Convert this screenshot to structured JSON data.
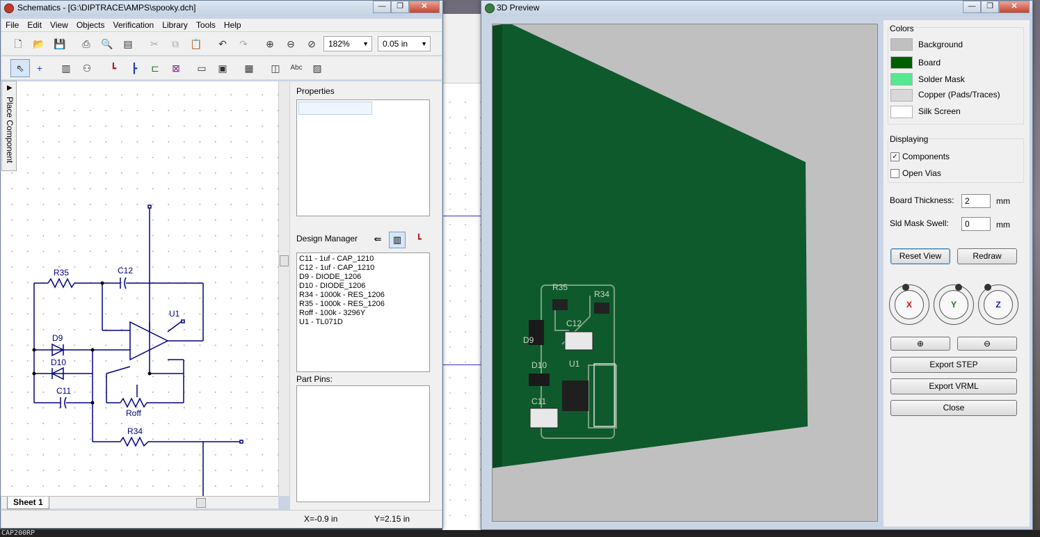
{
  "schematic_window": {
    "title": "Schematics - [G:\\DIPTRACE\\AMPS\\spooky.dch]",
    "menu": [
      "File",
      "Edit",
      "View",
      "Objects",
      "Verification",
      "Library",
      "Tools",
      "Help"
    ],
    "zoom": "182%",
    "grid": "0.05 in",
    "side_tab": "Place Component",
    "sheet_tab": "Sheet 1",
    "properties_label": "Properties",
    "design_manager_label": "Design Manager",
    "design_manager_items": [
      "C11 - 1uf - CAP_1210",
      "C12 - 1uf - CAP_1210",
      "D9 - DIODE_1206",
      "D10 - DIODE_1206",
      "R34 - 1000k - RES_1206",
      "R35 - 1000k - RES_1206",
      "Roff - 100k - 3296Y",
      "U1 - TL071D"
    ],
    "part_pins_label": "Part Pins:",
    "status_x": "X=-0.9 in",
    "status_y": "Y=2.15 in",
    "schematic_labels": {
      "r35": "R35",
      "c12": "C12",
      "u1": "U1",
      "d9": "D9",
      "d10": "D10",
      "c11": "C11",
      "roff": "Roff",
      "r34": "R34"
    }
  },
  "preview_window": {
    "title": "3D Preview",
    "colors_label": "Colors",
    "colors": [
      {
        "label": "Background",
        "hex": "#c0c0c0"
      },
      {
        "label": "Board",
        "hex": "#006000"
      },
      {
        "label": "Solder Mask",
        "hex": "#55e890"
      },
      {
        "label": "Copper (Pads/Traces)",
        "hex": "#d8d8d8"
      },
      {
        "label": "Silk Screen",
        "hex": "#ffffff"
      }
    ],
    "displaying_label": "Displaying",
    "components_label": "Components",
    "components_checked": true,
    "open_vias_label": "Open Vias",
    "open_vias_checked": false,
    "board_thickness_label": "Board Thickness:",
    "board_thickness_value": "2",
    "board_thickness_unit": "mm",
    "mask_swell_label": "Sld Mask Swell:",
    "mask_swell_value": "0",
    "mask_swell_unit": "mm",
    "reset_view": "Reset View",
    "redraw": "Redraw",
    "axes": [
      "X",
      "Y",
      "Z"
    ],
    "export_step": "Export STEP",
    "export_vrml": "Export VRML",
    "close": "Close",
    "board_labels": [
      "R35",
      "R34",
      "D9",
      "C12",
      "D10",
      "U1",
      "C11"
    ]
  },
  "taskbar_fragment": "CAP200RP",
  "accent_colors": {
    "board_green": "#0f5a2c",
    "wire_navy": "#000080",
    "title_bg": "#c9d5e4"
  }
}
